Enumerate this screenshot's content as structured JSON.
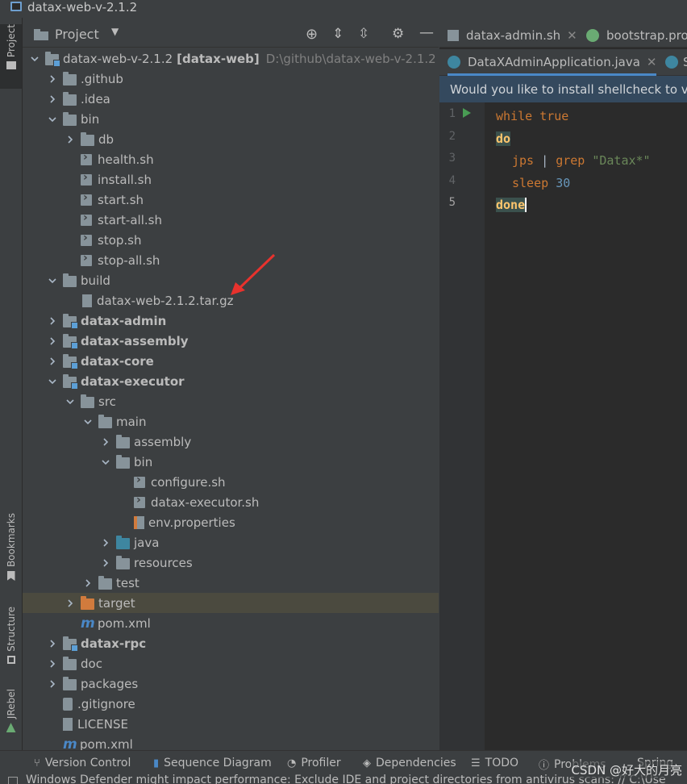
{
  "window": {
    "title": "datax-web-v-2.1.2"
  },
  "left_strip": {
    "project": "Project",
    "bookmarks": "Bookmarks",
    "structure": "Structure",
    "jrebel": "JRebel"
  },
  "project_panel": {
    "title": "Project"
  },
  "tree": {
    "root_name": "datax-web-v-2.1.2",
    "root_module": "[datax-web]",
    "root_path": "D:\\github\\datax-web-v-2.1.2",
    "items": [
      "datax-web-v-2.1.2",
      ".github",
      ".idea",
      "bin",
      "db",
      "health.sh",
      "install.sh",
      "start.sh",
      "start-all.sh",
      "stop.sh",
      "stop-all.sh",
      "build",
      "datax-web-2.1.2.tar.gz",
      "datax-admin",
      "datax-assembly",
      "datax-core",
      "datax-executor",
      "src",
      "main",
      "assembly",
      "bin",
      "configure.sh",
      "datax-executor.sh",
      "env.properties",
      "java",
      "resources",
      "test",
      "target",
      "pom.xml",
      "datax-rpc",
      "doc",
      "packages",
      ".gitignore",
      "LICENSE",
      "pom.xml"
    ]
  },
  "editor": {
    "tabs_top": [
      "datax-admin.sh",
      "bootstrap.pro"
    ],
    "tabs_second": [
      "DataXAdminApplication.java",
      "S"
    ],
    "banner": "Would you like to install shellcheck to ve",
    "line_numbers": [
      "1",
      "2",
      "3",
      "4",
      "5"
    ],
    "code": {
      "l1_a": "while",
      "l1_b": "true",
      "l2": "do",
      "l3_a": "jps",
      "l3_b": "|",
      "l3_c": "grep",
      "l3_d": "\"Datax*\"",
      "l4_a": "sleep",
      "l4_b": "30",
      "l5": "done"
    }
  },
  "statusbar": {
    "items": [
      "Version Control",
      "Sequence Diagram",
      "Profiler",
      "Dependencies",
      "TODO",
      "Problems",
      "Spring"
    ],
    "bottom_text": "Windows Defender might impact performance: Exclude IDE and project directories from antivirus scans: // C:\\Use"
  },
  "watermark": "CSDN @好大的月亮",
  "colors": {
    "background": "#3c3f41",
    "editor": "#2b2b2b",
    "arrow": "#e8322d"
  }
}
